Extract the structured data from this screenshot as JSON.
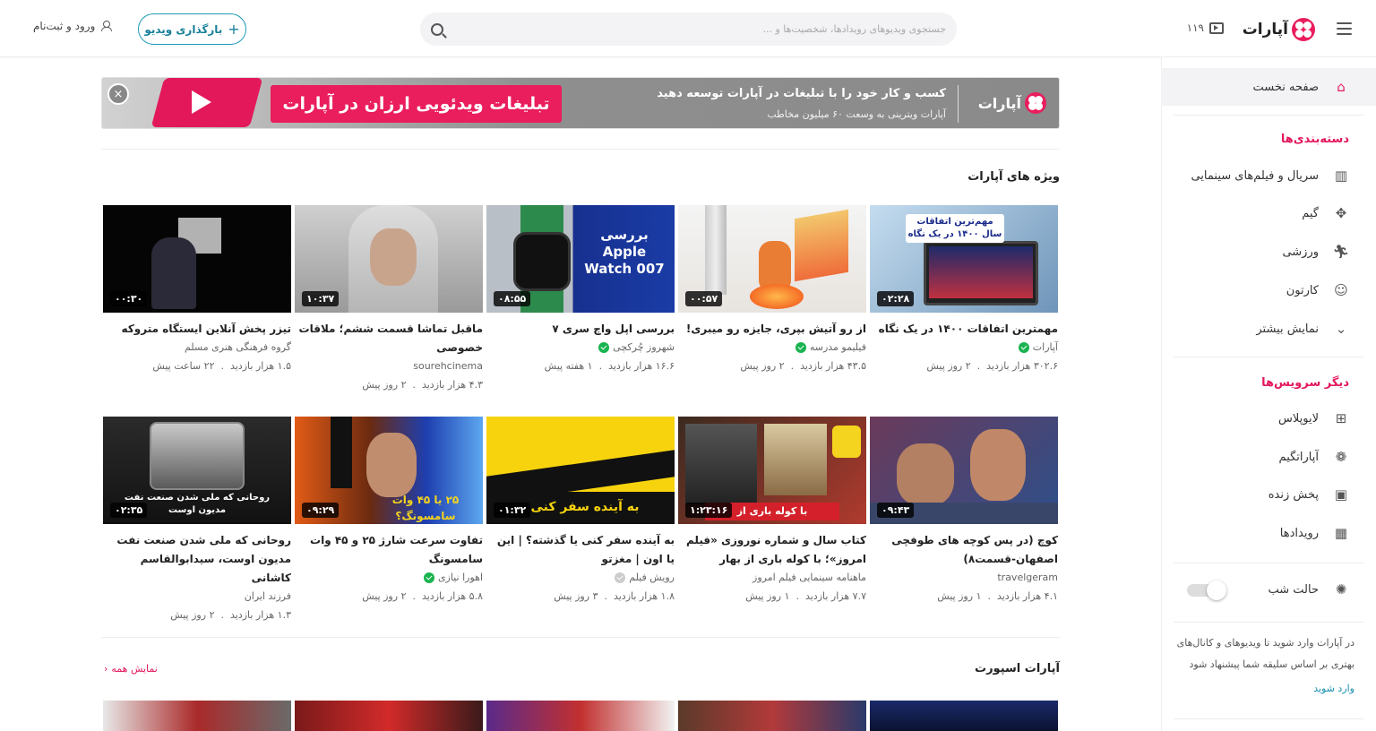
{
  "header": {
    "logo_text": "آپارات",
    "live_count": "۱۱۹",
    "search_placeholder": "جستجوی ویدیوهای رویدادها، شخصیت‌ها و ...",
    "upload_label": "بارگذاری ویدیو",
    "login_label": "ورود و ثبت‌نام"
  },
  "sidebar": {
    "home": "صفحه نخست",
    "categories_heading": "دسته‌بندی‌ها",
    "categories": [
      {
        "label": "سریال و فیلم‌های سینمایی",
        "icon": "film-icon"
      },
      {
        "label": "گیم",
        "icon": "gamepad-icon"
      },
      {
        "label": "ورزشی",
        "icon": "running-icon"
      },
      {
        "label": "کارتون",
        "icon": "cartoon-icon"
      },
      {
        "label": "نمایش بیشتر",
        "icon": "chevron-down-icon"
      }
    ],
    "services_heading": "دیگر سرویس‌ها",
    "services": [
      {
        "label": "لایوپلاس",
        "icon": "liveplus-icon"
      },
      {
        "label": "آپاراتگیم",
        "icon": "aparatgame-icon"
      },
      {
        "label": "پخش زنده",
        "icon": "live-tv-icon"
      },
      {
        "label": "رویدادها",
        "icon": "calendar-icon"
      }
    ],
    "night_mode": "حالت شب",
    "note": "در آپارات وارد شوید تا ویدیوهای و کانال‌های بهتری بر اساس سلیقه شما پیشنهاد شود",
    "login_link": "وارد شوید"
  },
  "banner": {
    "title": "کسب و کار خود را با تبلیغات در آپارات توسعه دهید",
    "subtitle": "آپارات ویترینی به وسعت ۶۰ میلیون مخاطب",
    "pink_text": "تبلیغات ویدئویی ارزان در آپارات",
    "close": "×",
    "logo_text": "آپارات"
  },
  "featured": {
    "title": "ویژه های آپارات",
    "videos": [
      {
        "title": "مهمترین اتفاقات ۱۴۰۰ در یک نگاه",
        "channel": "آپارات",
        "verified": "green",
        "views": "۳۰۲.۶ هزار بازدید",
        "age": "۲ روز پیش",
        "duration": "۰۲:۲۸",
        "thumb_text": "مهم‌ترین اتفاقات سال ۱۴۰۰ در یک نگاه"
      },
      {
        "title": "از رو آتیش بپری، جایزه رو میبری!",
        "channel": "فیلیمو مدرسه",
        "verified": "green",
        "views": "۴۳.۵ هزار بازدید",
        "age": "۲ روز پیش",
        "duration": "۰۰:۵۷",
        "thumb_text": ""
      },
      {
        "title": "بررسی اپل واچ سری ۷",
        "channel": "شهروز چُرکچی",
        "verified": "green",
        "views": "۱۶.۶ هزار بازدید",
        "age": "۱ هفته پیش",
        "duration": "۰۸:۵۵",
        "thumb_text": "بررسی Apple Watch 007"
      },
      {
        "title": "ماقبل تماشا قسمت ششم؛ ملاقات خصوصی",
        "channel": "sourehcinema",
        "verified": "none",
        "views": "۴.۳ هزار بازدید",
        "age": "۲ روز پیش",
        "duration": "۱۰:۳۷",
        "thumb_text": ""
      },
      {
        "title": "تیزر پخش آنلاین ایستگاه متروکه",
        "channel": "گروه فرهنگی هنری مسلم",
        "verified": "none",
        "views": "۱.۵ هزار بازدید",
        "age": "۲۲ ساعت پیش",
        "duration": "۰۰:۳۰",
        "thumb_text": ""
      },
      {
        "title": "کوچ (در پس کوچه های طوفچی اصفهان-قسمت۸)",
        "channel": "travelgeram",
        "verified": "none",
        "views": "۴.۱ هزار بازدید",
        "age": "۱ روز پیش",
        "duration": "۰۹:۴۳",
        "thumb_text": ""
      },
      {
        "title": "کتاب سال و شماره نوروزی «فیلم امروز»؛ با کوله باری از بهار",
        "channel": "ماهنامه سینمایی فیلم امروز",
        "verified": "none",
        "views": "۷.۷ هزار بازدید",
        "age": "۱ روز پیش",
        "duration": "۱:۲۳:۱۶",
        "thumb_text": "با کوله باری از"
      },
      {
        "title": "به آینده سفر کنی یا گذشته؟ | این یا اون | مغزتو",
        "channel": "رویش فیلم",
        "verified": "grey",
        "views": "۱.۸ هزار بازدید",
        "age": "۳ روز پیش",
        "duration": "۰۱:۳۲",
        "thumb_text": "به آینده سفر کنی"
      },
      {
        "title": "تفاوت سرعت شارژ ۲۵ و ۴۵ وات سامسونگ",
        "channel": "اهورا نیازی",
        "verified": "green",
        "views": "۵.۸ هزار بازدید",
        "age": "۲ روز پیش",
        "duration": "۰۹:۲۹",
        "thumb_text": "۲۵ یا ۴۵ وات سامسونگ؟"
      },
      {
        "title": "روحانی که ملی شدن صنعت نفت مدیون اوست، سیدابوالقاسم کاشانی",
        "channel": "فرزند ایران",
        "verified": "none",
        "views": "۱.۳ هزار بازدید",
        "age": "۲ روز پیش",
        "duration": "۰۲:۳۵",
        "thumb_text": "روحانی که ملی شدن صنعت نفت مدیون اوست"
      }
    ]
  },
  "sport": {
    "title": "آپارات اسپورت",
    "show_all": "نمایش همه"
  },
  "colors": {
    "accent": "#e3185a",
    "link": "#1a8fb0",
    "verified": "#19b34f"
  }
}
